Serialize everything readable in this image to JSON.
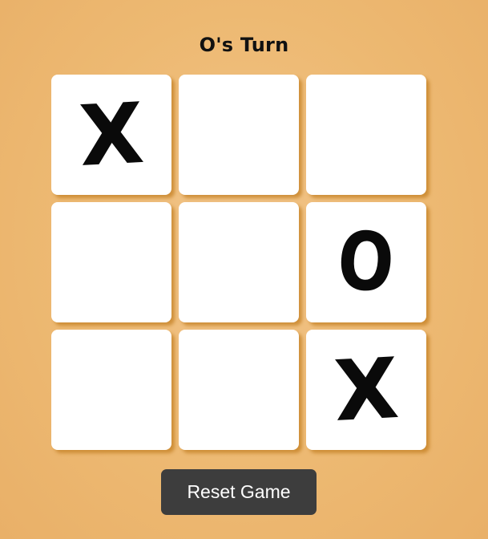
{
  "status": {
    "turn_text": "O's Turn"
  },
  "board": {
    "cells": [
      {
        "mark": "X"
      },
      {
        "mark": ""
      },
      {
        "mark": ""
      },
      {
        "mark": ""
      },
      {
        "mark": ""
      },
      {
        "mark": "O"
      },
      {
        "mark": ""
      },
      {
        "mark": ""
      },
      {
        "mark": "X"
      }
    ]
  },
  "controls": {
    "reset_label": "Reset Game"
  },
  "colors": {
    "background": "#edb972",
    "cell": "#ffffff",
    "cell_shadow": "#c48024",
    "mark": "#0a0a0a",
    "button": "#3d3d3d",
    "button_text": "#ffffff"
  }
}
